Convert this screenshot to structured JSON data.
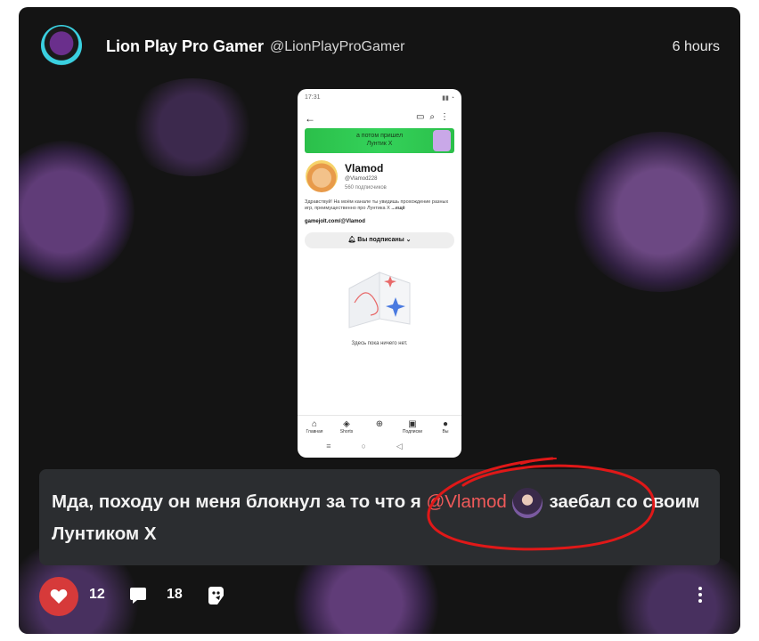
{
  "post": {
    "author_name": "Lion Play Pro Gamer",
    "author_handle": "@LionPlayProGamer",
    "time": "6 hours",
    "caption_before": "Мда, походу он меня блокнул за то что я ",
    "mention": "@Vlamod",
    "caption_after": " заебал со своим Лунтиком X"
  },
  "screenshot": {
    "status_time": "17:31",
    "banner_text_1": "а потом пришел",
    "banner_text_2": "Лунтик X",
    "channel_name": "Vlamod",
    "channel_handle": "@Vlamod228",
    "subscribers": "560 подписчиков",
    "description": "Здравствуй! На моём канале ты увидишь прохождение разных игр, преимущественно про Лунтика X",
    "description_more": "...ещё",
    "link": "gamejolt.com/@Vlamod",
    "subscribed_label": "Вы подписаны",
    "empty_text": "Здесь пока ничего нет.",
    "nav": [
      "Главная",
      "Shorts",
      "",
      "Подписки",
      "Вы"
    ]
  },
  "actions": {
    "likes": "12",
    "comments": "18"
  },
  "colors": {
    "card_bg": "#141414",
    "caption_bg": "#2b2d30",
    "mention": "#f05a5a",
    "like": "#d63a3a",
    "annotation": "#e01818"
  },
  "icons": {
    "like": "heart-icon",
    "comment": "comment-icon",
    "share": "share-icon",
    "more": "more-vertical-icon"
  }
}
